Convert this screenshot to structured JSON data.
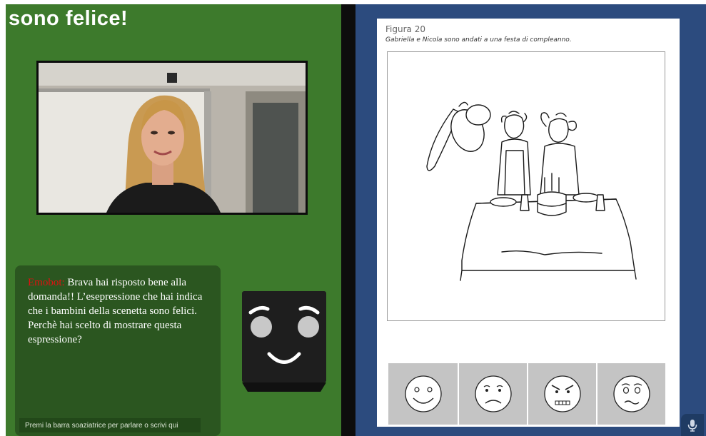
{
  "header": {
    "title": "sono felice!"
  },
  "chat": {
    "sender": "Emobot:",
    "message": " Brava hai risposto bene alla domanda!! L’esepressione che hai indica che i bambini della scenetta sono felici. Perchè hai scelto di mostrare questa espressione?",
    "input_placeholder": "Premi la barra soaziatrice per parlare o scrivi qui"
  },
  "emobot": {
    "expression": "smile"
  },
  "video": {
    "icon": "webcam-feed"
  },
  "worksheet": {
    "figure_label": "Figura 20",
    "caption": "Gabriella e Nicola sono andati a una festa di compleanno.",
    "faces": [
      {
        "emotion": "happy"
      },
      {
        "emotion": "sad"
      },
      {
        "emotion": "angry"
      },
      {
        "emotion": "scared"
      }
    ]
  },
  "colors": {
    "left_panel": "#3d7a2c",
    "chat_panel": "#2b5620",
    "right_panel": "#2c4b7e",
    "sender": "#e01010"
  },
  "controls": {
    "mic_icon": "microphone-icon"
  }
}
